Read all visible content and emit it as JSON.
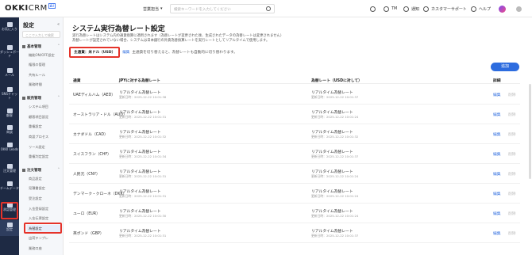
{
  "topbar": {
    "logo": "OKKICRM",
    "logo_main": "OKKI",
    "logo_crm": "CRM",
    "logo_badge": "AI",
    "scope": "営業担当",
    "search_placeholder": "検索キーワードを入力してください",
    "user": "TM",
    "notify": "通知",
    "support": "カスタマーサポート",
    "help": "ヘルプ"
  },
  "rail": {
    "items": [
      {
        "label": "お気に入り",
        "icon": "star-icon"
      },
      {
        "label": "ダッシュボード",
        "icon": "dashboard-icon"
      },
      {
        "label": "メール",
        "icon": "mail-icon"
      },
      {
        "label": "SNSチャット",
        "icon": "chat-icon"
      },
      {
        "label": "顧客",
        "icon": "customer-icon"
      },
      {
        "label": "商談",
        "icon": "deal-icon"
      },
      {
        "label": "OKKI Leads",
        "icon": "leads-icon"
      },
      {
        "label": "注文管理",
        "icon": "order-icon"
      },
      {
        "label": "チームデータ",
        "icon": "team-data-icon"
      },
      {
        "label": "承認管理",
        "icon": "approval-icon"
      },
      {
        "label": "設定",
        "icon": "settings-icon"
      }
    ]
  },
  "sidebar": {
    "title": "設定",
    "search_placeholder": "ここで入力して検索",
    "groups": [
      {
        "label": "基本管理",
        "items": [
          "機能ON/OFF設定",
          "権限の管理",
          "共有ルール",
          "業務時間"
        ]
      },
      {
        "label": "販売管理",
        "items": [
          "システム項目",
          "顧客項目設定",
          "重複設定",
          "商談プロセス",
          "リース設定",
          "重複判定設定"
        ]
      },
      {
        "label": "注文管理",
        "items": [
          "商品設定",
          "見積書設定",
          "受注設定",
          "入金登録設定",
          "入金伝票設定",
          "為替設定",
          "出荷テンプレ",
          "業務口座"
        ]
      }
    ]
  },
  "main": {
    "title": "システム実行為替レート設定",
    "desc_line1": "実行為替レートはシステム内の通貨換算に適用されます（為替レートが変更された後、生成されたデータの為替レートは変更されません）",
    "desc_line2": "為替レートが設定されていない場合、システムは日本銀行の外貨為替換算レートを実行レートとしてリアルタイムで使用します。",
    "base_currency": "主通貨：米ドル（USD）",
    "base_edit": "編集",
    "base_note": "主通貨を切り替えると、為替レートも自動的に切り替わります。",
    "add_button": "追加",
    "columns": [
      "通貨",
      "JPYに対する為替レート",
      "為替レート（USDに対して）",
      "詳細"
    ],
    "rows": [
      {
        "currency": "UAEディルハム（AED）",
        "rate_jpy": "リアルタイム為替レート",
        "upd_jpy": "更新日時：2025-12-22 10:01:36",
        "rate_usd": "リアルタイム為替レート",
        "upd_usd": "更新日時：2025-12-22 10:01:37"
      },
      {
        "currency": "オーストラリア・ドル（AUD）",
        "rate_jpy": "リアルタイム為替レート",
        "upd_jpy": "更新日時：2025-12-22 10:01:31",
        "rate_usd": "リアルタイム為替レート",
        "upd_usd": "更新日時：2025-12-22 10:01:24"
      },
      {
        "currency": "カナダドル（CAD）",
        "rate_jpy": "リアルタイム為替レート",
        "upd_jpy": "更新日時：2025-12-22 10:01:32",
        "rate_usd": "リアルタイム為替レート",
        "upd_usd": "更新日時：2025-12-22 10:01:32"
      },
      {
        "currency": "スイスフラン（CHF）",
        "rate_jpy": "リアルタイム為替レート",
        "upd_jpy": "更新日時：2025-12-22 10:01:34",
        "rate_usd": "リアルタイム為替レート",
        "upd_usd": "更新日時：2025-12-22 10:01:37"
      },
      {
        "currency": "人民元（CNY）",
        "rate_jpy": "リアルタイム為替レート",
        "upd_jpy": "更新日時：2025-12-22 10:01:31",
        "rate_usd": "リアルタイム為替レート",
        "upd_usd": "更新日時：2025-12-22 10:01:24"
      },
      {
        "currency": "デンマーク・クローネ（DKK）",
        "rate_jpy": "リアルタイム為替レート",
        "upd_jpy": "更新日時：2025-12-22 10:01:31",
        "rate_usd": "リアルタイム為替レート",
        "upd_usd": "更新日時：2025-12-22 10:01:24"
      },
      {
        "currency": "ユーロ（EUR）",
        "rate_jpy": "リアルタイム為替レート",
        "upd_jpy": "更新日時：2025-12-22 10:01:30",
        "rate_usd": "リアルタイム為替レート",
        "upd_usd": "更新日時：2025-12-22 10:01:24"
      },
      {
        "currency": "英ポンド（GBP）",
        "rate_jpy": "リアルタイム為替レート",
        "upd_jpy": "更新日時：2025-12-22 10:01:31",
        "rate_usd": "リアルタイム為替レート",
        "upd_usd": "更新日時：2025-12-22 10:01:37"
      }
    ],
    "edit_label": "編集",
    "delete_label": "削除"
  },
  "colors": {
    "accent": "#2d6cdf",
    "highlight": "#e5332a",
    "rail_bg": "#1e2a44"
  }
}
